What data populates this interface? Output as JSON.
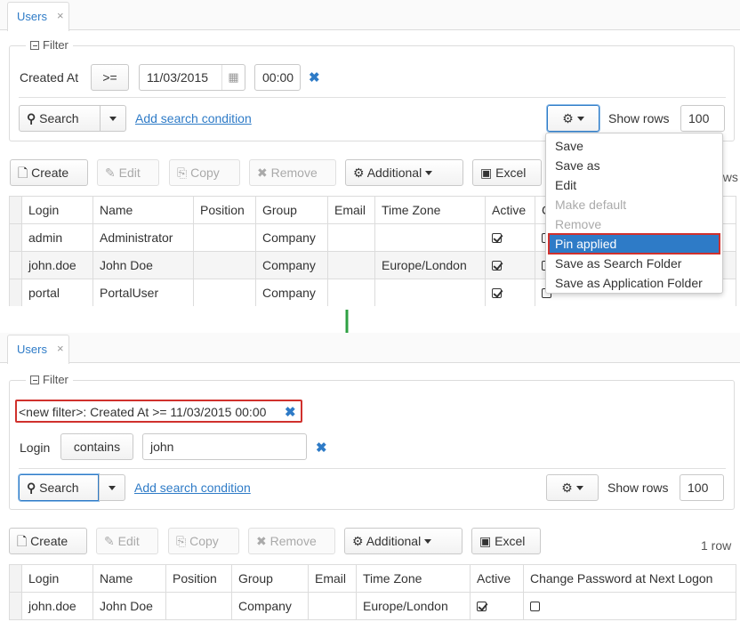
{
  "top": {
    "tab": {
      "label": "Users",
      "close": "×"
    },
    "filter": {
      "legend": "Filter",
      "condition": {
        "label": "Created At",
        "operator": ">=",
        "date": "11/03/2015",
        "time": "00:00"
      },
      "search_label": "Search",
      "add_condition": "Add search condition",
      "show_rows_label": "Show rows",
      "show_rows_value": "100"
    },
    "toolbar": {
      "create": "Create",
      "edit": "Edit",
      "copy": "Copy",
      "remove": "Remove",
      "additional": "Additional",
      "excel": "Excel",
      "rows_count": "ows"
    },
    "table": {
      "headers": [
        "Login",
        "Name",
        "Position",
        "Group",
        "Email",
        "Time Zone",
        "Active",
        "C"
      ],
      "rows": [
        {
          "login": "admin",
          "name": "Administrator",
          "position": "",
          "group": "Company",
          "email": "",
          "timezone": "",
          "active": true
        },
        {
          "login": "john.doe",
          "name": "John Doe",
          "position": "",
          "group": "Company",
          "email": "",
          "timezone": "Europe/London",
          "active": true
        },
        {
          "login": "portal",
          "name": "PortalUser",
          "position": "",
          "group": "Company",
          "email": "",
          "timezone": "",
          "active": true
        }
      ]
    },
    "menu": {
      "items": [
        {
          "label": "Save",
          "disabled": false
        },
        {
          "label": "Save as",
          "disabled": false
        },
        {
          "label": "Edit",
          "disabled": false
        },
        {
          "label": "Make default",
          "disabled": true
        },
        {
          "label": "Remove",
          "disabled": true
        },
        {
          "label": "Pin applied",
          "disabled": false,
          "highlighted": true
        },
        {
          "label": "Save as Search Folder",
          "disabled": false
        },
        {
          "label": "Save as Application Folder",
          "disabled": false
        }
      ]
    }
  },
  "bottom": {
    "tab": {
      "label": "Users",
      "close": "×"
    },
    "filter": {
      "legend": "Filter",
      "pinned": "<new filter>: Created At >= 11/03/2015 00:00",
      "condition": {
        "label": "Login",
        "operator": "contains",
        "value": "john"
      },
      "search_label": "Search",
      "add_condition": "Add search condition",
      "show_rows_label": "Show rows",
      "show_rows_value": "100"
    },
    "toolbar": {
      "create": "Create",
      "edit": "Edit",
      "copy": "Copy",
      "remove": "Remove",
      "additional": "Additional",
      "excel": "Excel",
      "rows_count": "1 row"
    },
    "table": {
      "headers": [
        "Login",
        "Name",
        "Position",
        "Group",
        "Email",
        "Time Zone",
        "Active",
        "Change Password at Next Logon"
      ],
      "rows": [
        {
          "login": "john.doe",
          "name": "John Doe",
          "position": "",
          "group": "Company",
          "email": "",
          "timezone": "Europe/London",
          "active": true,
          "change_pw": false
        }
      ]
    }
  },
  "colors": {
    "accent": "#2e7bc7",
    "highlight_border": "#d0312d",
    "arrow": "#2ea043"
  }
}
